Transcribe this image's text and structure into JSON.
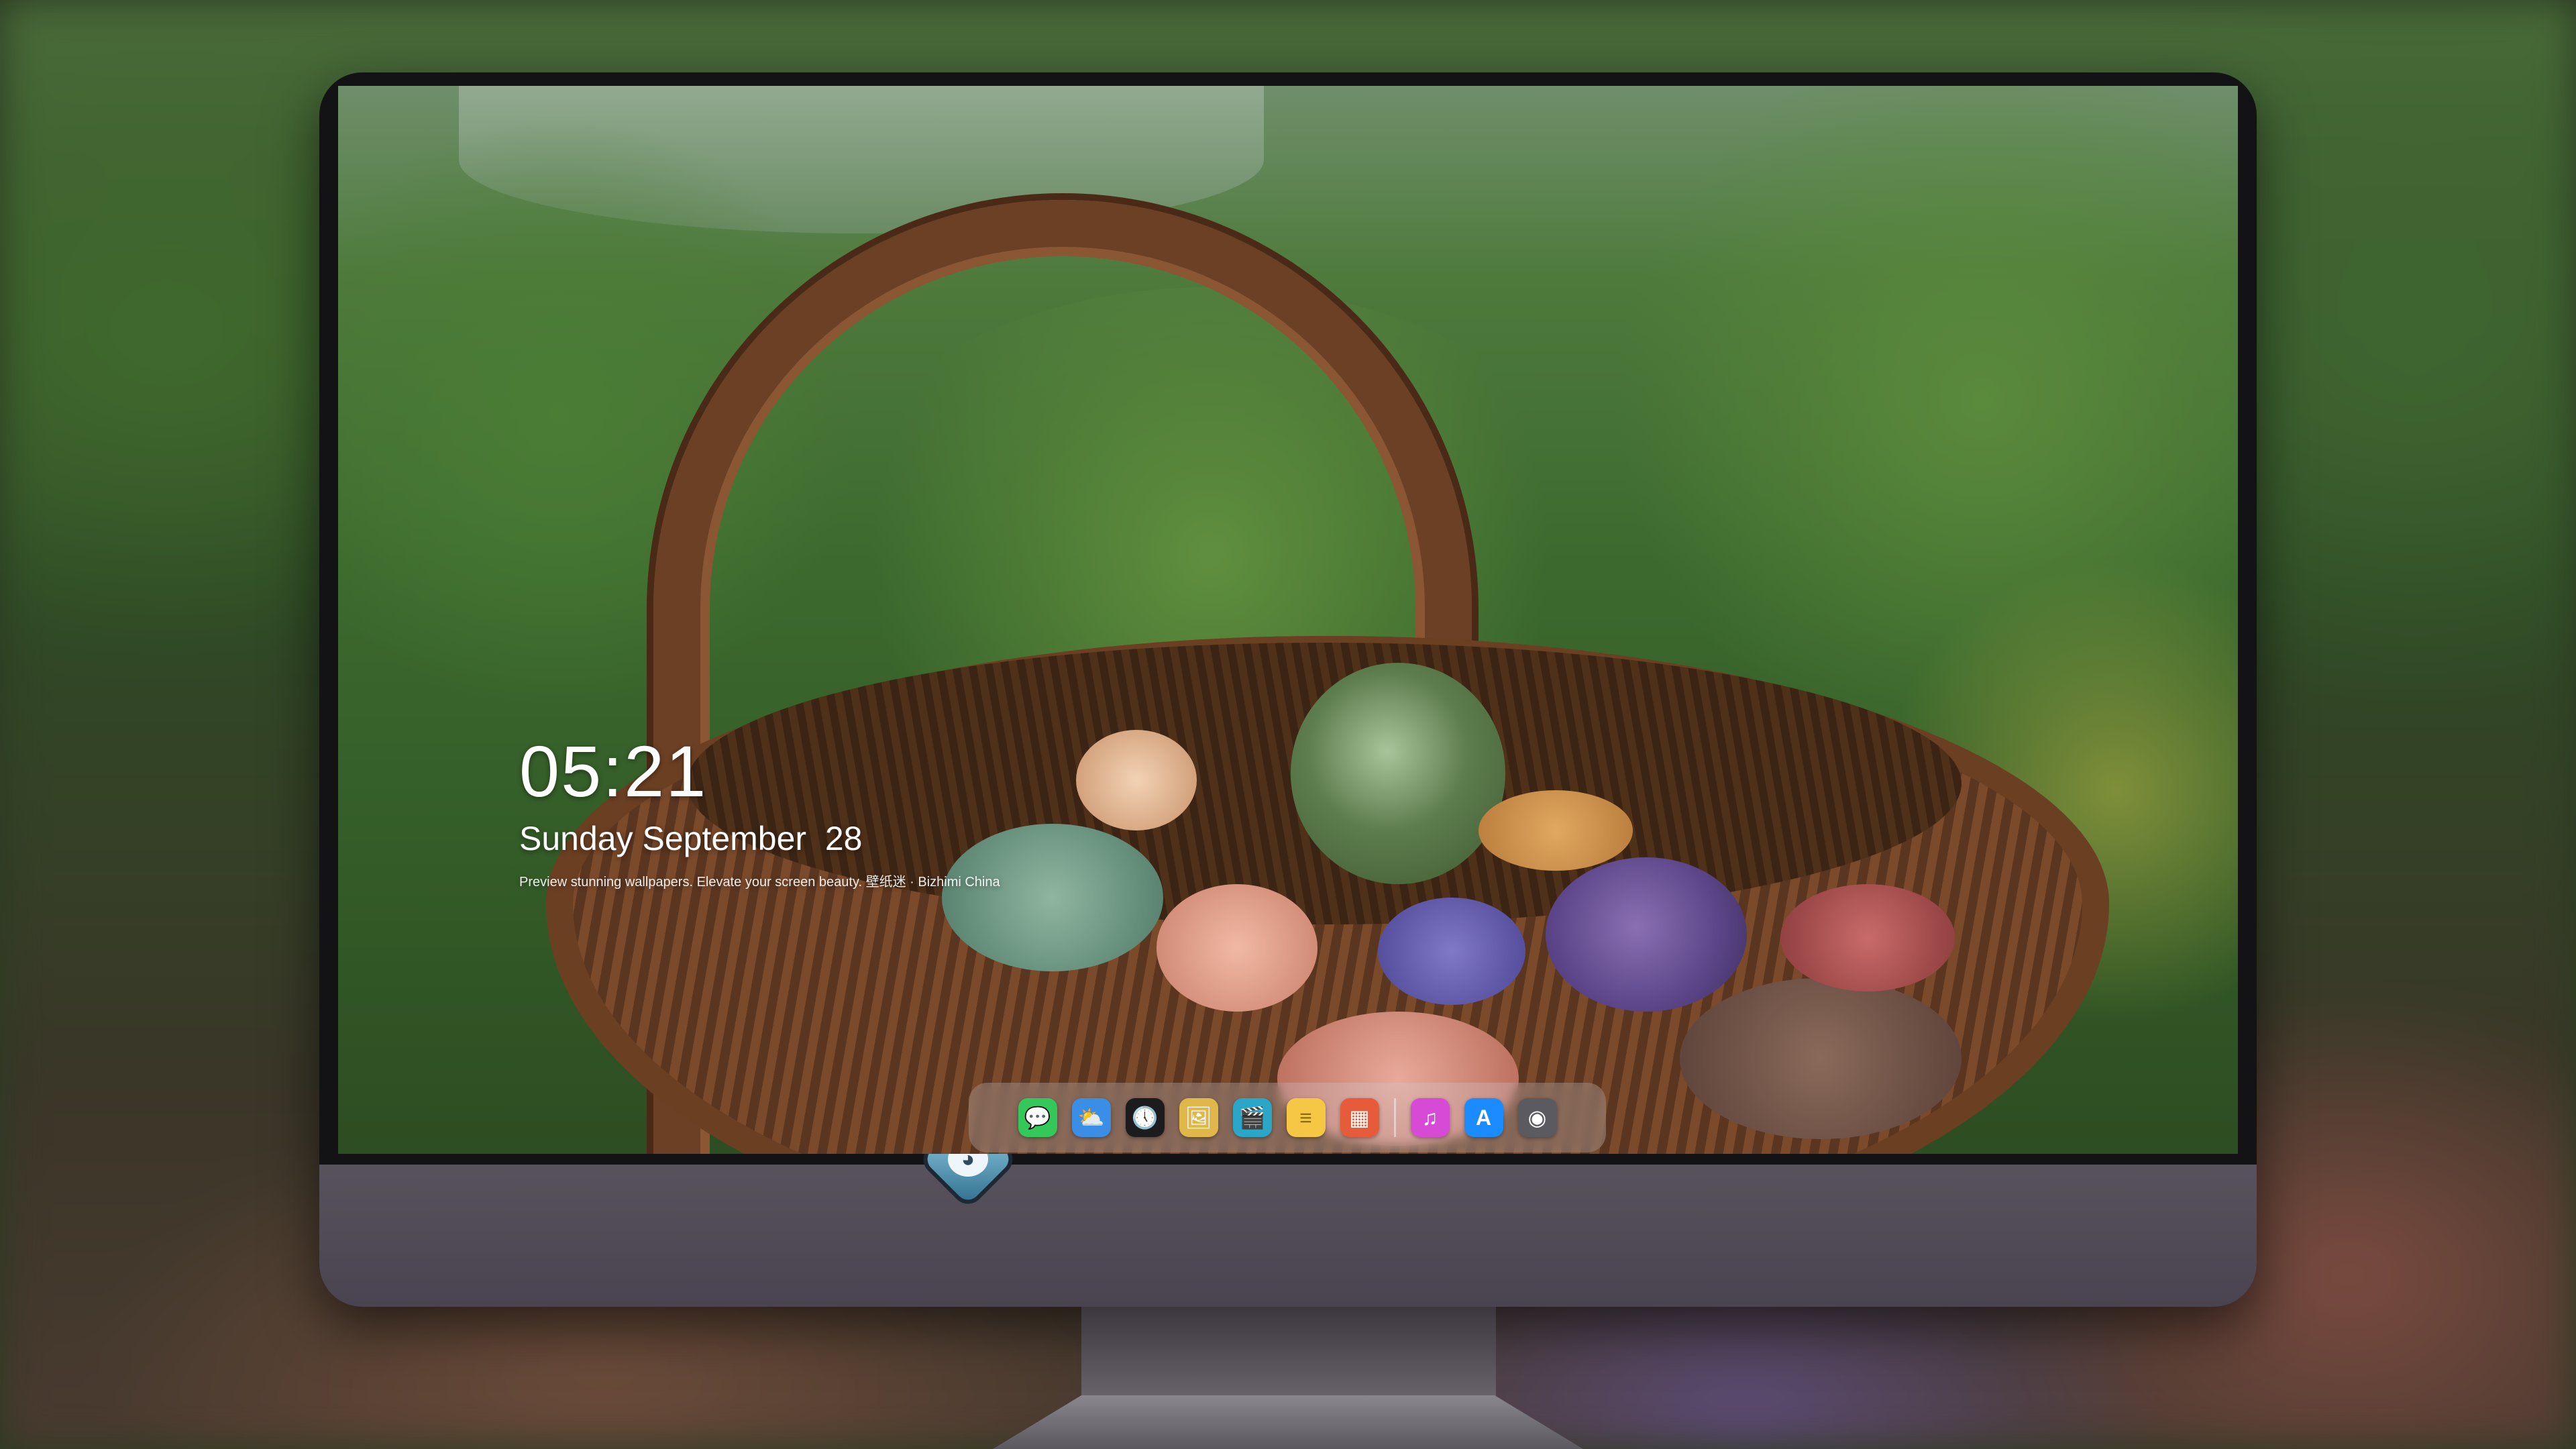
{
  "lockscreen": {
    "time": "05:21",
    "date": "Sunday September  28",
    "tagline": "Preview stunning wallpapers. Elevate your screen beauty. 壁纸迷 · Bizhimi China"
  },
  "dock": {
    "apps": [
      {
        "name": "Messages",
        "icon": "messages-icon",
        "glyph": "💬",
        "color": "#34c759"
      },
      {
        "name": "Weather",
        "icon": "weather-icon",
        "glyph": "⛅",
        "color": "#3a8ee6"
      },
      {
        "name": "Clock",
        "icon": "clock-icon",
        "glyph": "🕔",
        "color": "#1c1c1e"
      },
      {
        "name": "Preview",
        "icon": "preview-icon",
        "glyph": "🖼",
        "color": "#e0b84a"
      },
      {
        "name": "Clips",
        "icon": "clips-icon",
        "glyph": "🎬",
        "color": "#2aa7c8"
      },
      {
        "name": "Notes",
        "icon": "notes-icon",
        "glyph": "≡",
        "color": "#f6c744"
      },
      {
        "name": "Photo Booth",
        "icon": "photo-booth-icon",
        "glyph": "▦",
        "color": "#e65c3a"
      },
      {
        "name": "iTunes",
        "icon": "music-icon",
        "glyph": "♫",
        "color": "#d64ad6"
      },
      {
        "name": "App Store",
        "icon": "app-store-icon",
        "glyph": "A",
        "color": "#1a8cff"
      },
      {
        "name": "Camera",
        "icon": "camera-icon",
        "glyph": "◉",
        "color": "#5a5a60"
      }
    ]
  }
}
